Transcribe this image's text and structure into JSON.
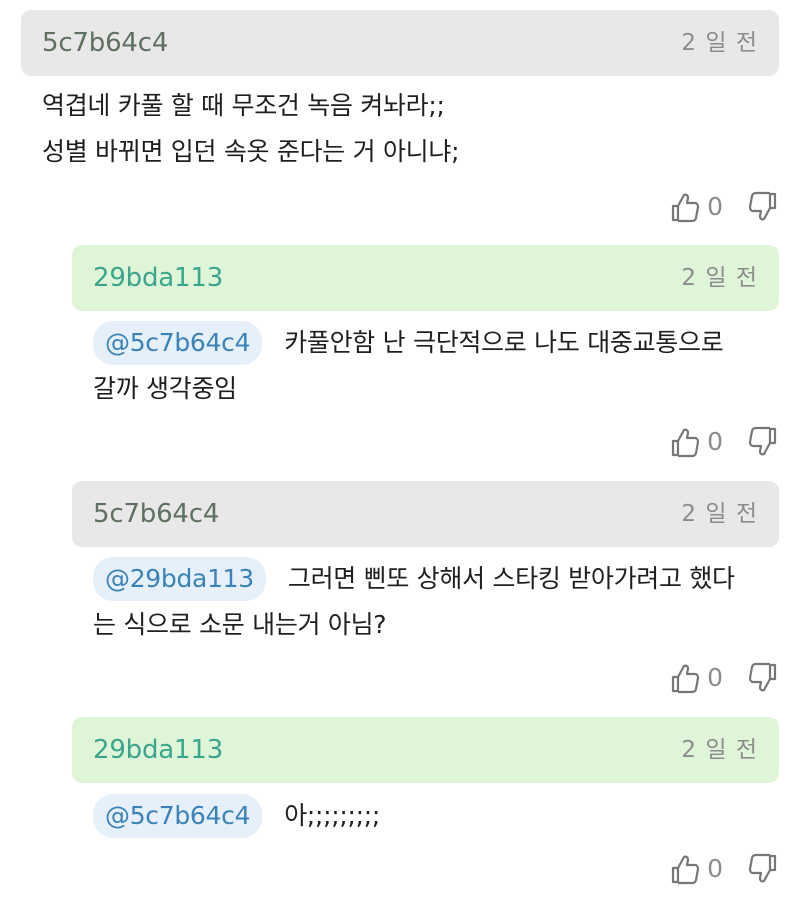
{
  "comments": [
    {
      "author": "5c7b64c4",
      "time": "2 일 전",
      "mention": "",
      "lines": [
        "역겹네 카풀 할 때 무조건 녹음 켜놔라;;",
        "성별 바뀌면 입던 속옷 준다는 거 아니냐;"
      ],
      "likes": "0",
      "header_style": "gray"
    },
    {
      "author": "29bda113",
      "time": "2 일 전",
      "mention": "@5c7b64c4",
      "lines": [
        "카풀안함 난 극단적으로 나도 대중교통으로",
        "갈까 생각중임"
      ],
      "likes": "0",
      "header_style": "green"
    },
    {
      "author": "5c7b64c4",
      "time": "2 일 전",
      "mention": "@29bda113",
      "lines": [
        "그러면 삔또 상해서 스타킹 받아가려고 했다",
        "는 식으로 소문 내는거 아님?"
      ],
      "likes": "0",
      "header_style": "gray"
    },
    {
      "author": "29bda113",
      "time": "2 일 전",
      "mention": "@5c7b64c4",
      "lines": [
        "아;;;;;;;;;"
      ],
      "likes": "0",
      "header_style": "green"
    }
  ],
  "icons": {
    "like": "thumbs-up-icon",
    "dislike": "thumbs-down-icon"
  },
  "colors": {
    "gray_header": "#e8e8e8",
    "green_header": "#dff5d7",
    "author_gray": "#5f7061",
    "author_green": "#3aa68e",
    "mention_text": "#3b82b8",
    "mention_bg": "#e6f0fb"
  }
}
